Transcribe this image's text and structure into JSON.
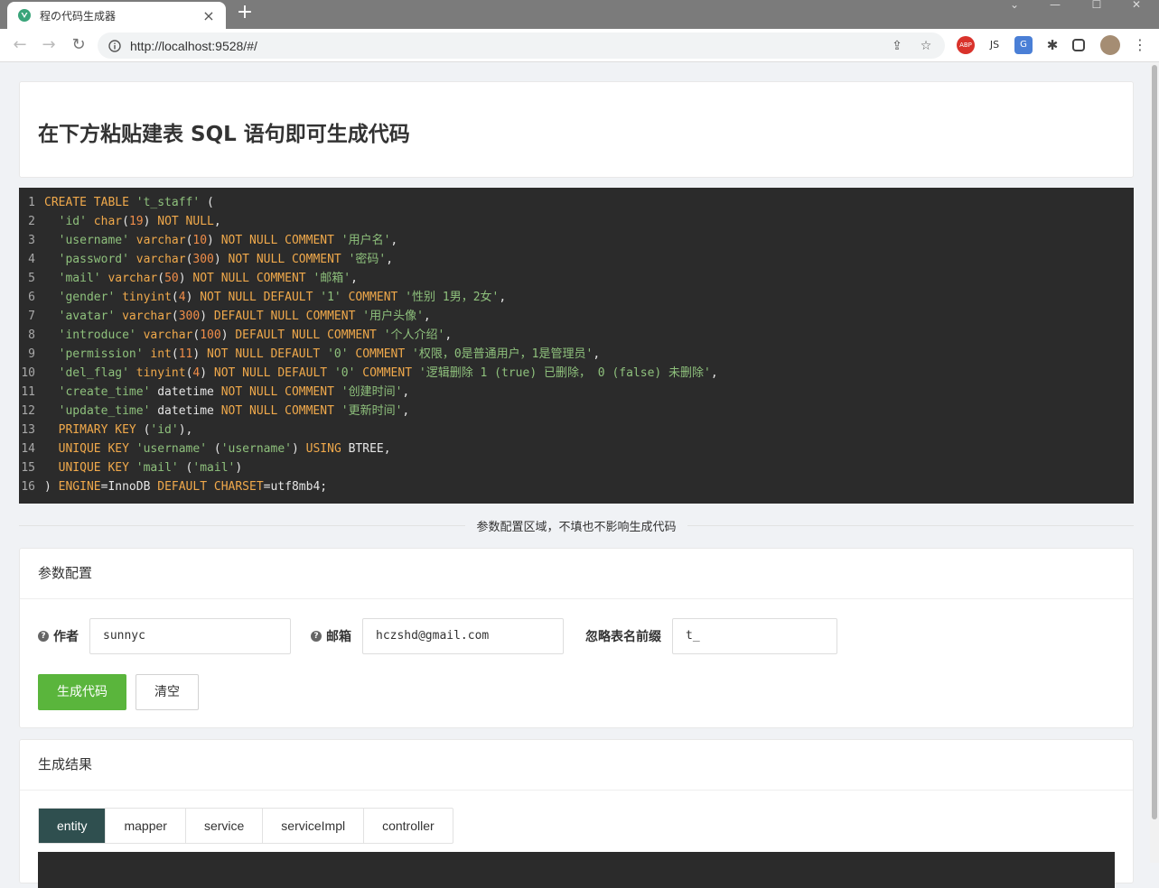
{
  "browser": {
    "tab_title": "程の代码生成器",
    "url": "http://localhost:9528/#/",
    "ext_abp": "ABP",
    "ext_js": "JS"
  },
  "page": {
    "title": "在下方粘贴建表 SQL 语句即可生成代码",
    "divider_text": "参数配置区域，不填也不影响生成代码"
  },
  "sql_lines": [
    "1",
    "2",
    "3",
    "4",
    "5",
    "6",
    "7",
    "8",
    "9",
    "10",
    "11",
    "12",
    "13",
    "14",
    "15",
    "16"
  ],
  "params": {
    "header": "参数配置",
    "author_label": "作者",
    "author_value": "sunnyc",
    "email_label": "邮箱",
    "email_value": "hczshd@gmail.com",
    "prefix_label": "忽略表名前缀",
    "prefix_value": "t_",
    "generate_button": "生成代码",
    "clear_button": "清空"
  },
  "result": {
    "header": "生成结果",
    "tabs": [
      "entity",
      "mapper",
      "service",
      "serviceImpl",
      "controller"
    ],
    "active_tab": "entity"
  },
  "colors": {
    "accent": "#5ab53c",
    "active_tab": "#2f4f4f",
    "code_bg": "#2b2b2b"
  }
}
